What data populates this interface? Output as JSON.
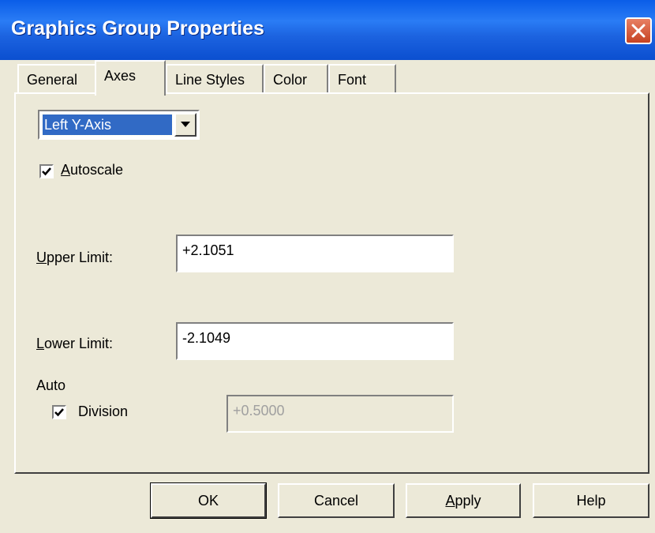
{
  "window": {
    "title": "Graphics Group Properties"
  },
  "tabs": [
    {
      "label": "General",
      "active": false
    },
    {
      "label": "Axes",
      "active": true
    },
    {
      "label": "Line Styles",
      "active": false
    },
    {
      "label": "Color",
      "active": false
    },
    {
      "label": "Font",
      "active": false
    }
  ],
  "axis_select": {
    "selected": "Left Y-Axis"
  },
  "autoscale": {
    "label_first": "A",
    "label_rest": "utoscale",
    "checked": true
  },
  "upper_limit": {
    "label_first": "U",
    "label_rest": "pper Limit:",
    "value": "+2.1051"
  },
  "lower_limit": {
    "label_first": "L",
    "label_rest": "ower Limit:",
    "value": "-2.1049"
  },
  "auto": {
    "heading": "Auto",
    "division_label": "Division",
    "division_checked": true,
    "division_value": "+0.5000"
  },
  "buttons": {
    "ok": "OK",
    "cancel": "Cancel",
    "apply_first": "A",
    "apply_rest": "pply",
    "help": "Help"
  },
  "colors": {
    "titlebar": "#0a5de8",
    "selection": "#316ac5",
    "close": "#c64322",
    "face": "#ece9d8"
  }
}
